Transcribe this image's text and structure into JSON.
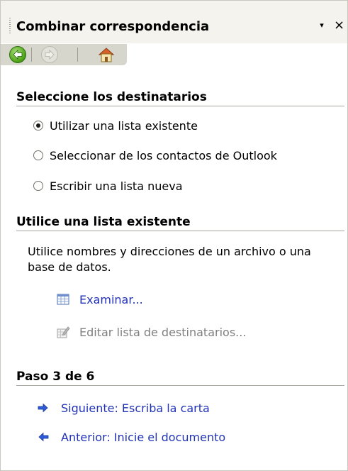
{
  "pane": {
    "title": "Combinar correspondencia",
    "menu_arrow": "▾",
    "close": "×"
  },
  "nav": {
    "back_icon": "green-back-arrow-icon",
    "forward_icon": "grey-forward-arrow-icon",
    "home_icon": "home-icon"
  },
  "recipients": {
    "heading": "Seleccione los destinatarios",
    "options": [
      {
        "label": "Utilizar una lista existente",
        "selected": true
      },
      {
        "label": "Seleccionar de los contactos de Outlook",
        "selected": false
      },
      {
        "label": "Escribir una lista nueva",
        "selected": false
      }
    ]
  },
  "existing_list": {
    "heading": "Utilice una lista existente",
    "description": "Utilice nombres y direcciones de un archivo o una base de datos.",
    "browse_label": "Examinar...",
    "edit_label": "Editar lista de destinatarios..."
  },
  "step": {
    "heading": "Paso 3 de 6",
    "next_label": "Siguiente: Escriba la carta",
    "previous_label": "Anterior: Inicie el documento"
  },
  "colors": {
    "link": "#2132b8",
    "disabled": "#7f7f7f",
    "nav_active": "#4aa012"
  }
}
